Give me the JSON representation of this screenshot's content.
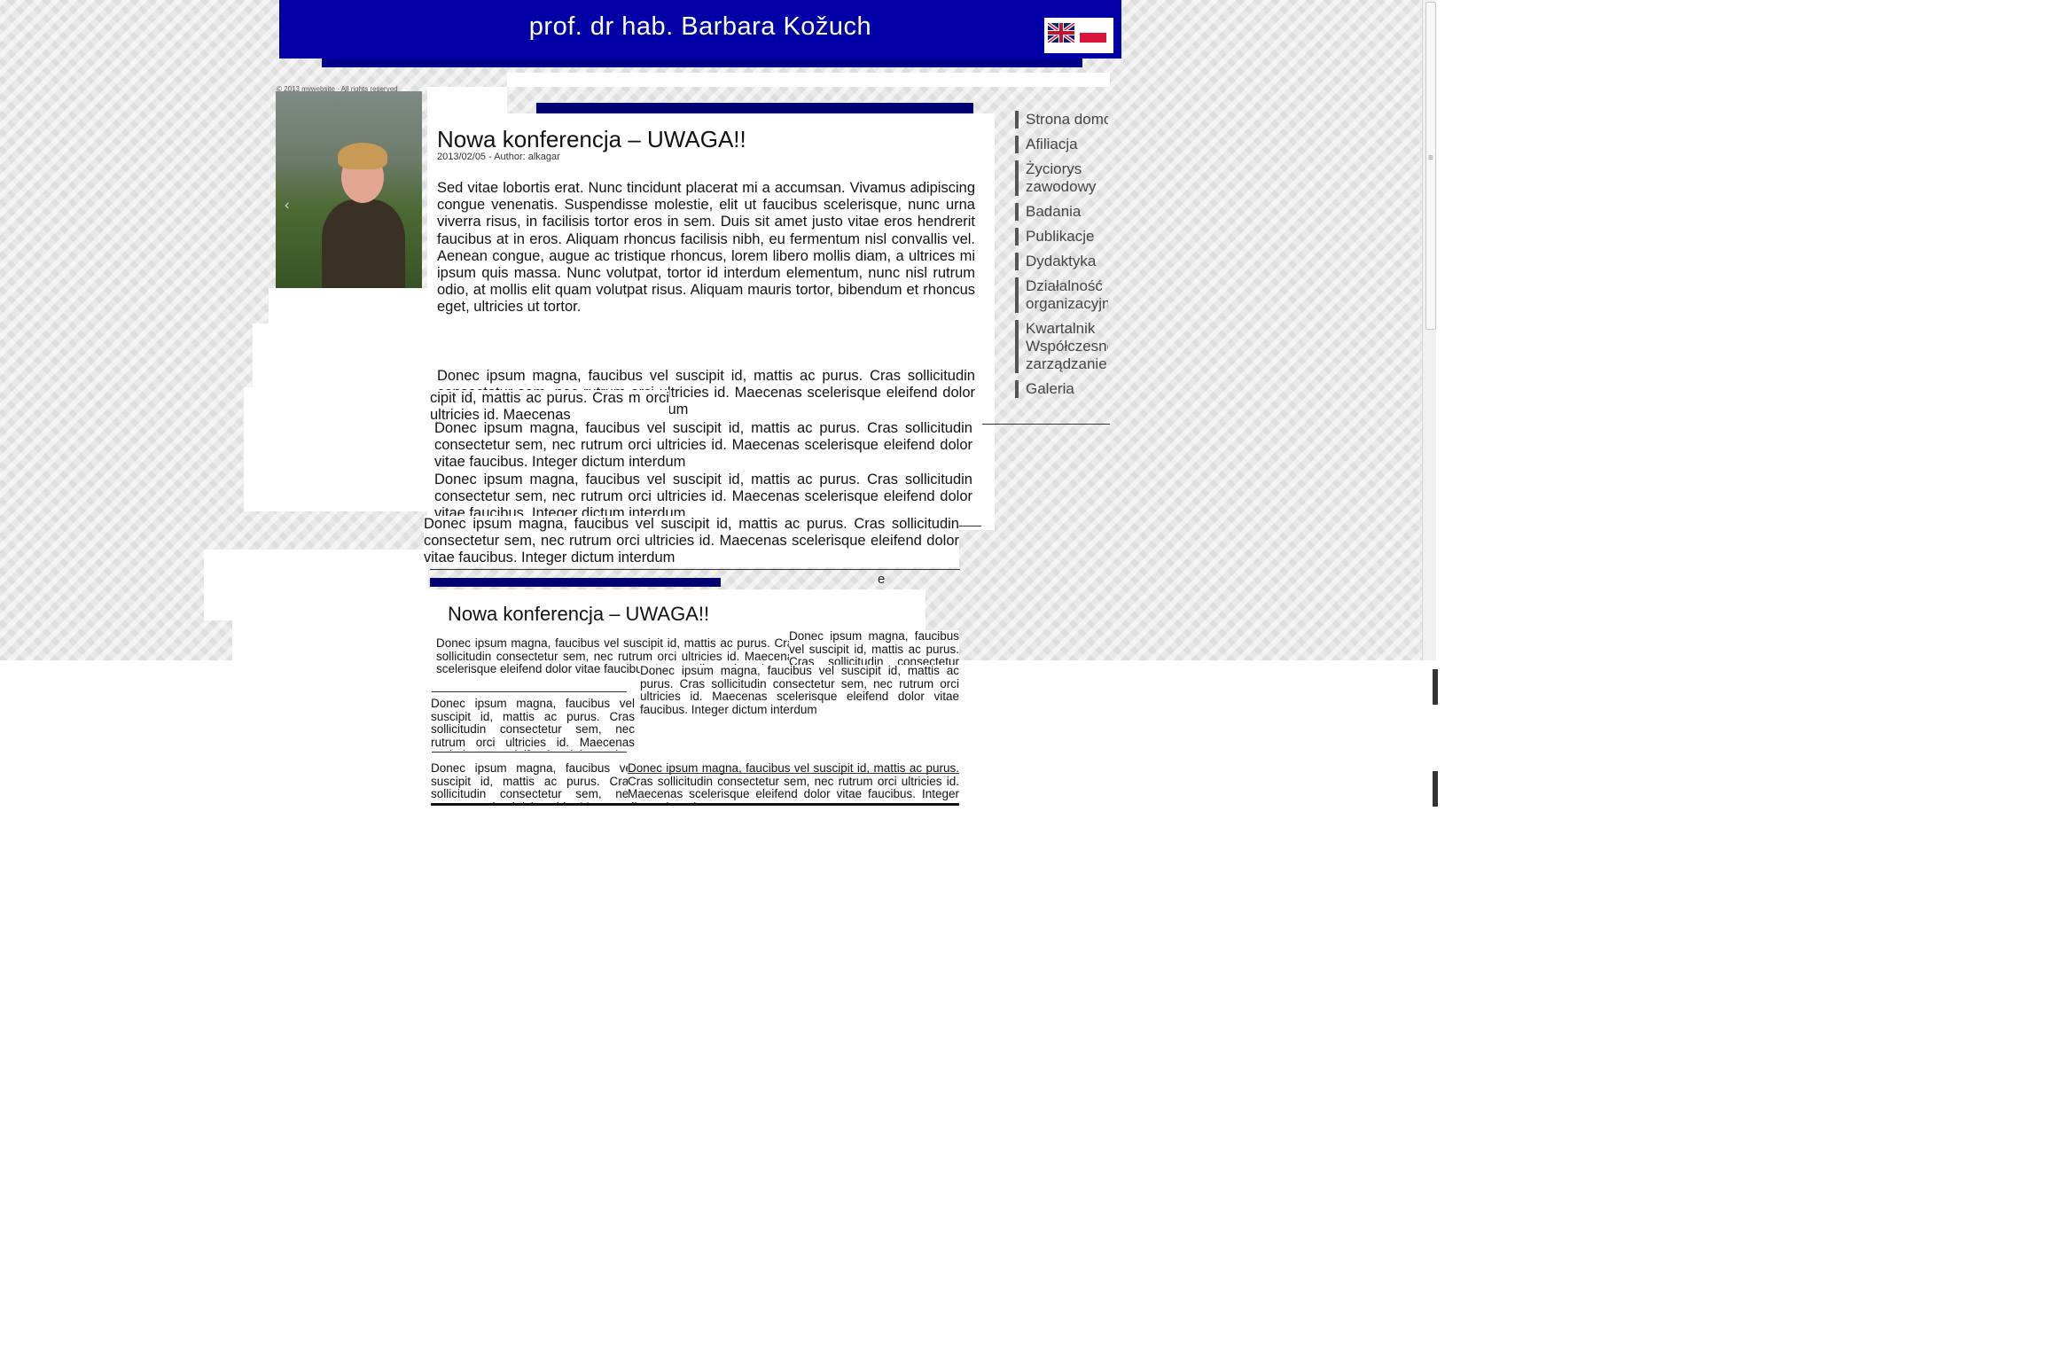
{
  "header": {
    "title": "prof. dr hab. Barbara Kožuch",
    "languages": [
      "English",
      "Polski"
    ],
    "colors": {
      "bar": "#0000a6",
      "title_text": "#ffffff"
    }
  },
  "sidebar": {
    "copyright": "© 2013 mywebsite · All rights reserved",
    "photo_alt": "portrait-photo"
  },
  "post": {
    "title": "Nowa konferencja – UWAGA!!",
    "meta": "2013/02/05 - Author: alkagar",
    "paragraph_1": "Sed vitae lobortis erat. Nunc tincidunt placerat mi a accumsan. Vivamus adipiscing congue venenatis. Suspendisse molestie, elit ut faucibus scelerisque, nunc urna viverra risus, in facilisis tortor eros in sem. Duis sit amet justo vitae eros hendrerit faucibus at in eros. Aliquam rhoncus facilisis nibh, eu fermentum nisl convallis vel. Aenean congue, augue ac tristique rhoncus, lorem libero mollis diam, a ultrices mi ipsum quis massa. Nunc volutpat, tortor id interdum elementum, nunc nisl rutrum odio, at mollis elit quam volutpat risus. Aliquam mauris tortor, bibendum et rhoncus eget, ultricies ut tortor.",
    "paragraph_2": "Donec ipsum magna, faucibus vel suscipit id, mattis ac purus. Cras sollicitudin consectetur sem, nec rutrum orci ultricies id. Maecenas scelerisque eleifend dolor vitae faucibus. Integer dictum interdum",
    "fragment": "cipit id, mattis ac purus. Cras m orci ultricies id. Maecenas",
    "stray_letter": "e"
  },
  "menu": {
    "items": [
      "Strona domowa",
      "Afiliacja",
      "Życiorys\nzawodowy",
      "Badania",
      "Publikacje",
      "Dydaktyka",
      "Działalność\norganizacyjna",
      "Kwartalnik\nWspółczesne\nzarządzanie",
      "Galeria"
    ]
  },
  "copy": {
    "title": "Nowa konferencja – UWAGA!!",
    "text": "Donec ipsum magna, faucibus vel suscipit id, mattis ac purus. Cras sollicitudin consectetur sem, nec rutrum orci ultricies id. Maecenas scelerisque eleifend dolor vitae faucibus. Integer dictum interdum"
  }
}
